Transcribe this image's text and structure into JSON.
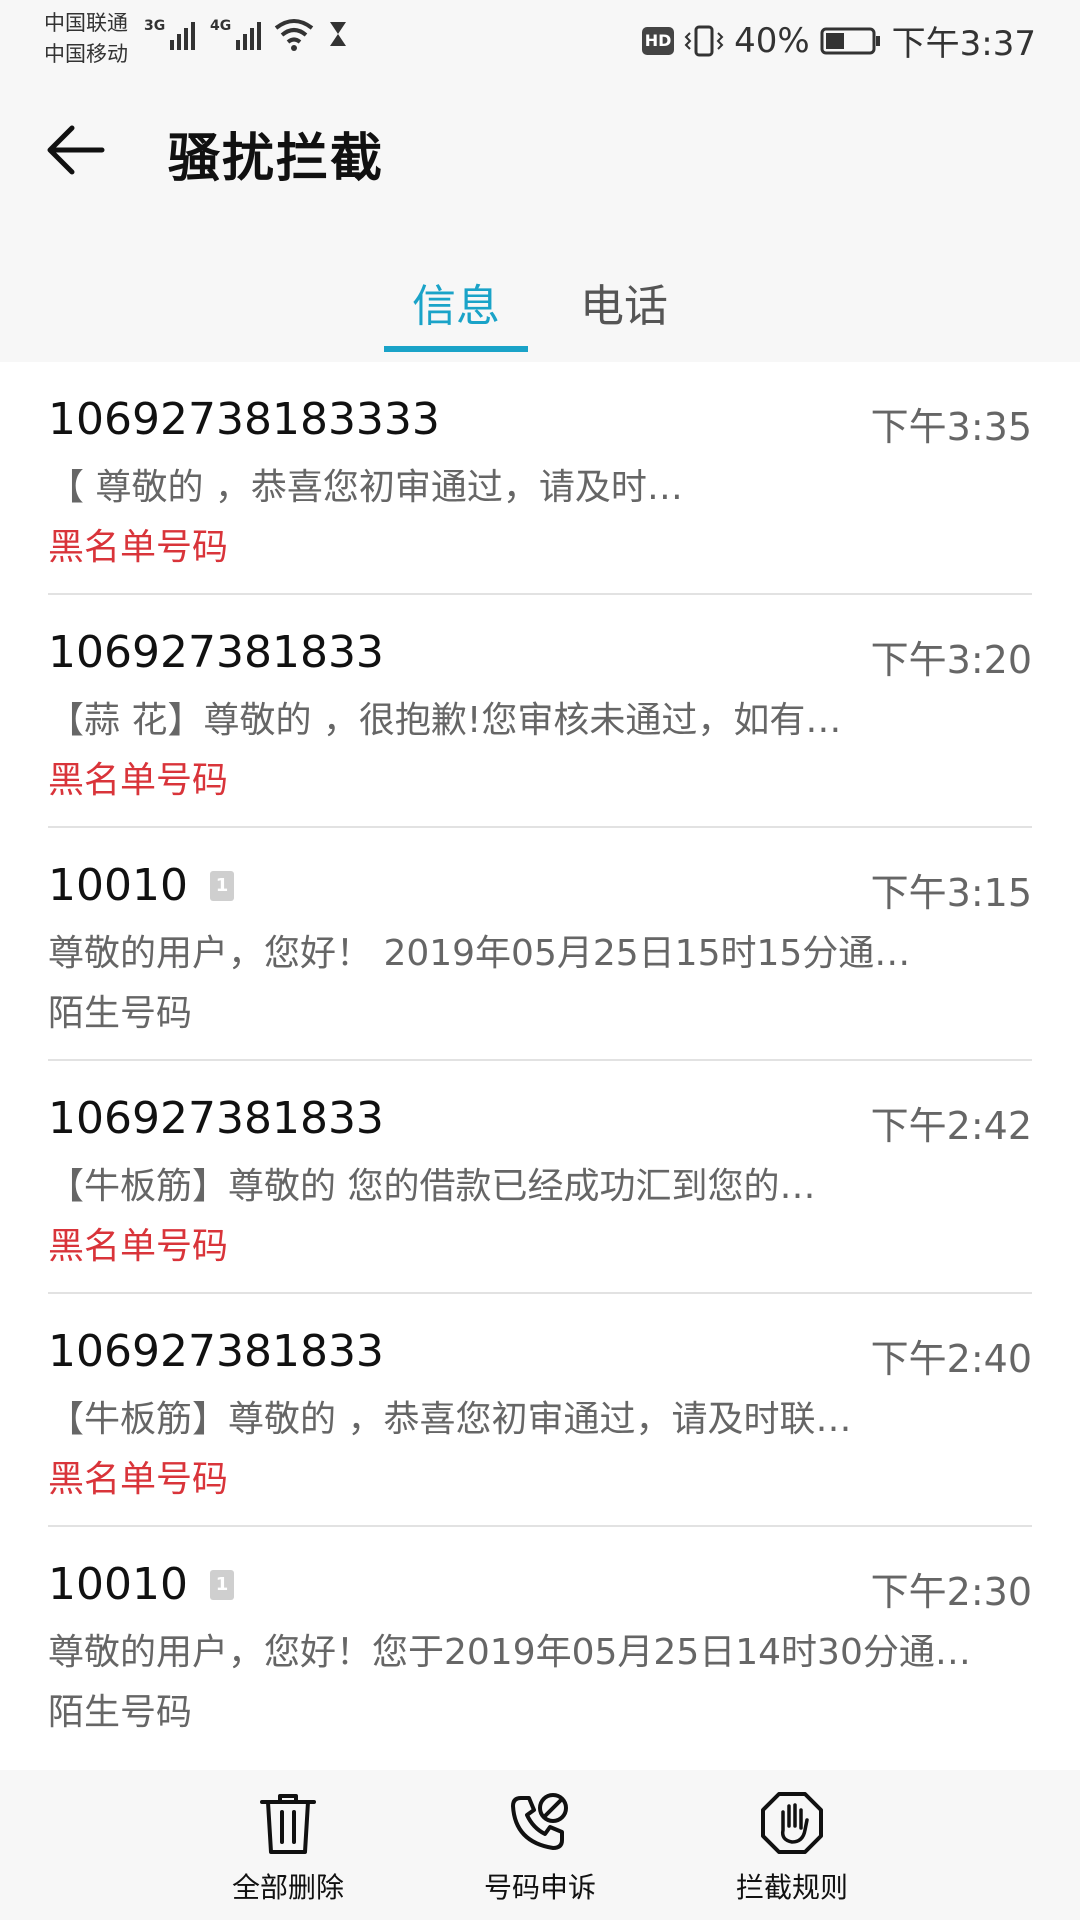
{
  "status_bar": {
    "carrier1": "中国联通",
    "carrier2": "中国移动",
    "net1": "3G",
    "net2": "4G",
    "hd": "HD",
    "battery": "40%",
    "time": "下午3:37"
  },
  "header": {
    "title": "骚扰拦截"
  },
  "tabs": [
    {
      "label": "信息",
      "active": true
    },
    {
      "label": "电话",
      "active": false
    }
  ],
  "messages": [
    {
      "number": "10692738183333",
      "time": "下午3:35",
      "preview": "【 尊敬的 ，恭喜您初审通过，请及时…",
      "tag": "黑名单号码",
      "tag_type": "blacklist",
      "sim": ""
    },
    {
      "number": "106927381833",
      "time": "下午3:20",
      "preview": "【蒜 花】尊敬的 ，很抱歉!您审核未通过，如有…",
      "tag": "黑名单号码",
      "tag_type": "blacklist",
      "sim": ""
    },
    {
      "number": "10010",
      "time": "下午3:15",
      "preview": "尊敬的用户，您好！ 2019年05月25日15时15分通…",
      "tag": "陌生号码",
      "tag_type": "stranger",
      "sim": "1"
    },
    {
      "number": "106927381833",
      "time": "下午2:42",
      "preview": "【牛板筋】尊敬的 您的借款已经成功汇到您的…",
      "tag": "黑名单号码",
      "tag_type": "blacklist",
      "sim": ""
    },
    {
      "number": "106927381833",
      "time": "下午2:40",
      "preview": "【牛板筋】尊敬的 ，恭喜您初审通过，请及时联…",
      "tag": "黑名单号码",
      "tag_type": "blacklist",
      "sim": ""
    },
    {
      "number": "10010",
      "time": "下午2:30",
      "preview": "尊敬的用户，您好！您于2019年05月25日14时30分通…",
      "tag": "陌生号码",
      "tag_type": "stranger",
      "sim": "1"
    }
  ],
  "bottom_actions": [
    {
      "label": "全部删除",
      "icon": "trash-icon"
    },
    {
      "label": "号码申诉",
      "icon": "phone-blocked-icon"
    },
    {
      "label": "拦截规则",
      "icon": "hand-stop-icon"
    }
  ],
  "colors": {
    "accent": "#1aa3c8",
    "blacklist": "#d9343a",
    "secondary_text": "#666666"
  }
}
